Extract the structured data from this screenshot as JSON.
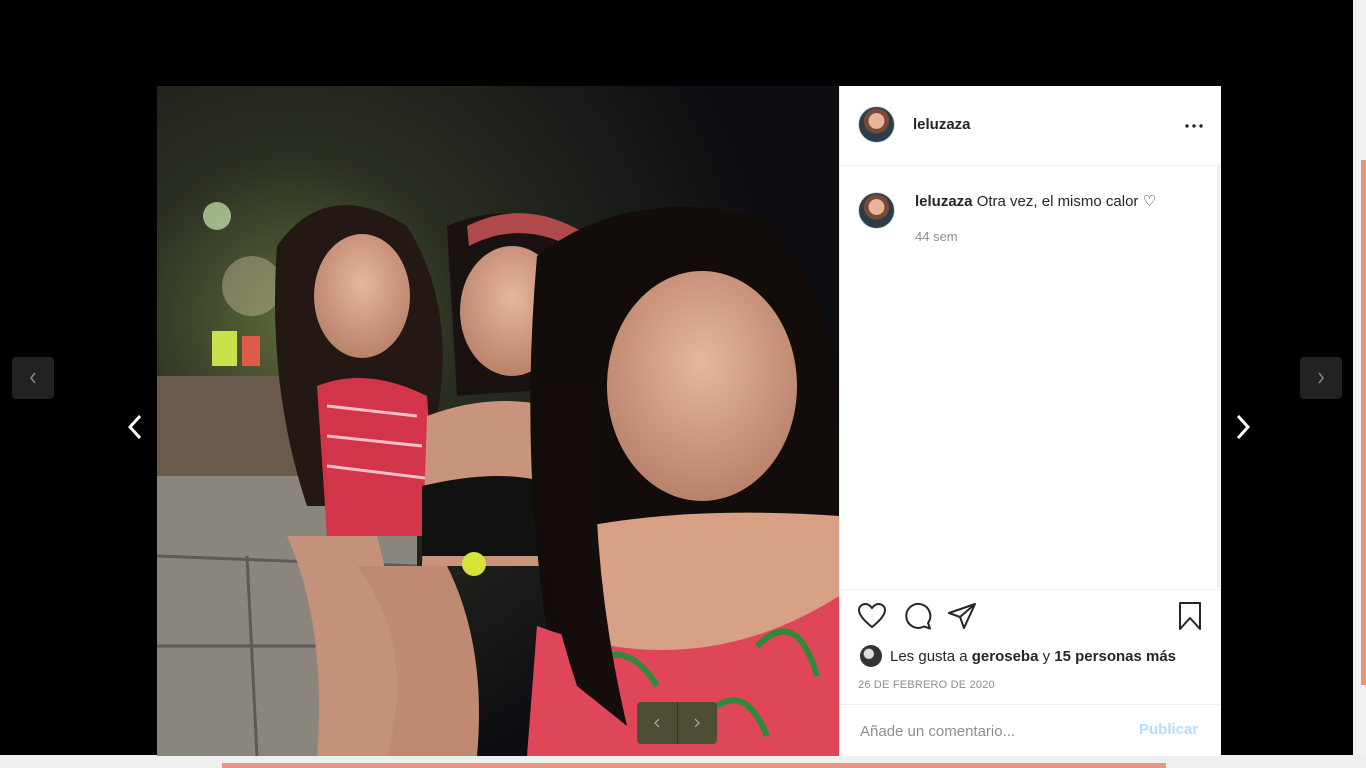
{
  "post": {
    "username": "leluzaza",
    "caption_text": "Otra vez, el mismo calor ♡",
    "time_ago": "44 sem",
    "date": "26 DE FEBRERO DE 2020"
  },
  "likes": {
    "prefix": "Les gusta a",
    "user": "geroseba",
    "connector": "y",
    "others": "15 personas más"
  },
  "comment": {
    "placeholder": "Añade un comentario...",
    "publish_label": "Publicar"
  },
  "colors": {
    "accent": "#e9967a",
    "publish_disabled": "#b2dffc"
  },
  "icons": [
    "chevron-left-icon",
    "chevron-right-icon",
    "more-icon",
    "heart-icon",
    "comment-icon",
    "share-icon",
    "bookmark-icon"
  ]
}
